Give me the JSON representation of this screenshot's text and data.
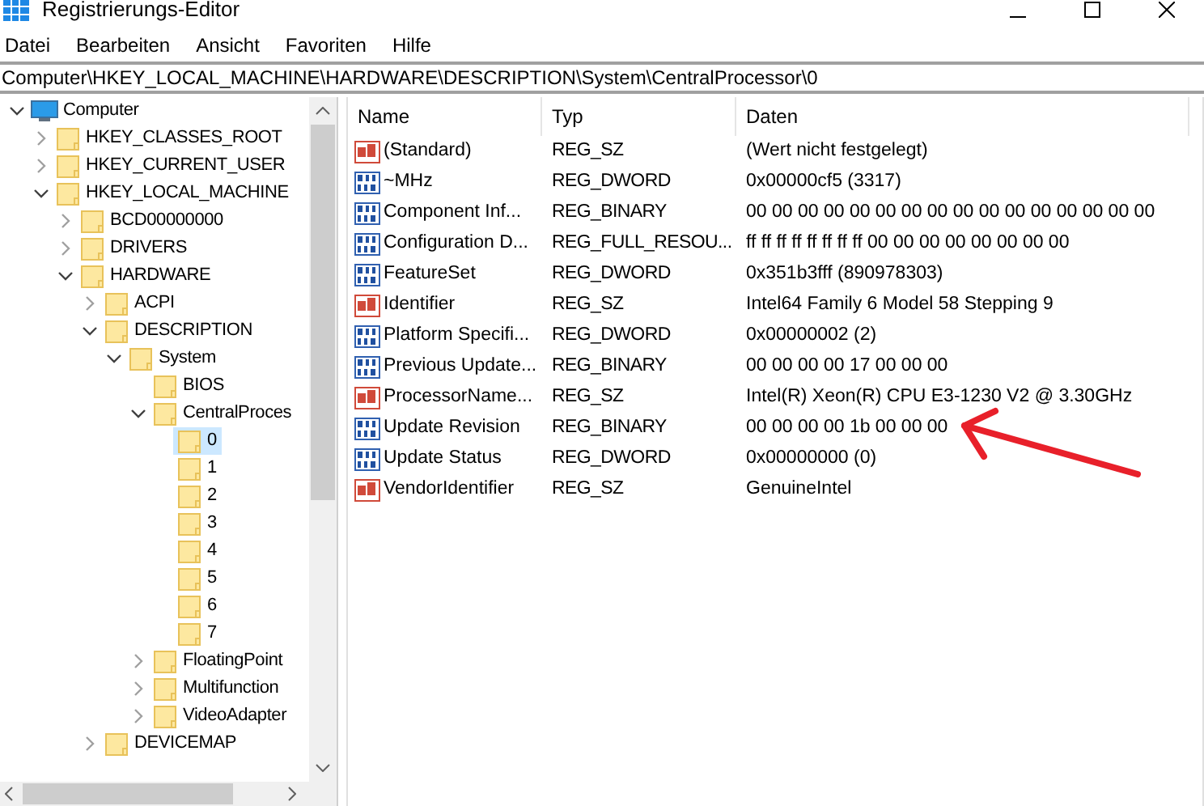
{
  "window": {
    "title": "Registrierungs-Editor"
  },
  "menu": [
    "Datei",
    "Bearbeiten",
    "Ansicht",
    "Favoriten",
    "Hilfe"
  ],
  "address": "Computer\\HKEY_LOCAL_MACHINE\\HARDWARE\\DESCRIPTION\\System\\CentralProcessor\\0",
  "tree": {
    "label": "Computer",
    "expanded": true,
    "selected": false,
    "children": [
      {
        "label": "HKEY_CLASSES_ROOT",
        "expanded": false,
        "selected": false
      },
      {
        "label": "HKEY_CURRENT_USER",
        "expanded": false,
        "selected": false
      },
      {
        "label": "HKEY_LOCAL_MACHINE",
        "expanded": true,
        "selected": false,
        "children": [
          {
            "label": "BCD00000000",
            "expanded": false,
            "selected": false
          },
          {
            "label": "DRIVERS",
            "expanded": false,
            "selected": false
          },
          {
            "label": "HARDWARE",
            "expanded": true,
            "selected": false,
            "children": [
              {
                "label": "ACPI",
                "expanded": false,
                "selected": false
              },
              {
                "label": "DESCRIPTION",
                "expanded": true,
                "selected": false,
                "children": [
                  {
                    "label": "System",
                    "expanded": true,
                    "selected": false,
                    "children": [
                      {
                        "label": "BIOS",
                        "selected": false
                      },
                      {
                        "label": "CentralProces",
                        "expanded": true,
                        "selected": false,
                        "children": [
                          {
                            "label": "0",
                            "selected": true
                          },
                          {
                            "label": "1",
                            "selected": false
                          },
                          {
                            "label": "2",
                            "selected": false
                          },
                          {
                            "label": "3",
                            "selected": false
                          },
                          {
                            "label": "4",
                            "selected": false
                          },
                          {
                            "label": "5",
                            "selected": false
                          },
                          {
                            "label": "6",
                            "selected": false
                          },
                          {
                            "label": "7",
                            "selected": false
                          }
                        ]
                      },
                      {
                        "label": "FloatingPoint",
                        "expanded": false,
                        "selected": false
                      },
                      {
                        "label": "Multifunction",
                        "expanded": false,
                        "selected": false
                      },
                      {
                        "label": "VideoAdapter",
                        "expanded": false,
                        "selected": false
                      }
                    ]
                  }
                ]
              },
              {
                "label": "DEVICEMAP",
                "expanded": false,
                "selected": false
              }
            ]
          }
        ]
      }
    ]
  },
  "table": {
    "columns": [
      "Name",
      "Typ",
      "Daten"
    ],
    "rows": [
      {
        "kind": "string",
        "name": "(Standard)",
        "type": "REG_SZ",
        "data": "(Wert nicht festgelegt)"
      },
      {
        "kind": "binary",
        "name": "~MHz",
        "type": "REG_DWORD",
        "data": "0x00000cf5 (3317)"
      },
      {
        "kind": "binary",
        "name": "Component Inf...",
        "type": "REG_BINARY",
        "data": "00 00 00 00 00 00 00 00 00 00 00 00 00 00 00 00"
      },
      {
        "kind": "binary",
        "name": "Configuration D...",
        "type": "REG_FULL_RESOU...",
        "data": "ff ff ff ff ff ff ff ff 00 00 00 00 00 00 00 00"
      },
      {
        "kind": "binary",
        "name": "FeatureSet",
        "type": "REG_DWORD",
        "data": "0x351b3fff (890978303)"
      },
      {
        "kind": "string",
        "name": "Identifier",
        "type": "REG_SZ",
        "data": "Intel64 Family 6 Model 58 Stepping 9"
      },
      {
        "kind": "binary",
        "name": "Platform Specifi...",
        "type": "REG_DWORD",
        "data": "0x00000002 (2)"
      },
      {
        "kind": "binary",
        "name": "Previous Update...",
        "type": "REG_BINARY",
        "data": "00 00 00 00 17 00 00 00"
      },
      {
        "kind": "string",
        "name": "ProcessorName...",
        "type": "REG_SZ",
        "data": "Intel(R) Xeon(R) CPU E3-1230 V2 @ 3.30GHz"
      },
      {
        "kind": "binary",
        "name": "Update Revision",
        "type": "REG_BINARY",
        "data": "00 00 00 00 1b 00 00 00"
      },
      {
        "kind": "binary",
        "name": "Update Status",
        "type": "REG_DWORD",
        "data": "0x00000000 (0)"
      },
      {
        "kind": "string",
        "name": "VendorIdentifier",
        "type": "REG_SZ",
        "data": "GenuineIntel"
      }
    ]
  }
}
